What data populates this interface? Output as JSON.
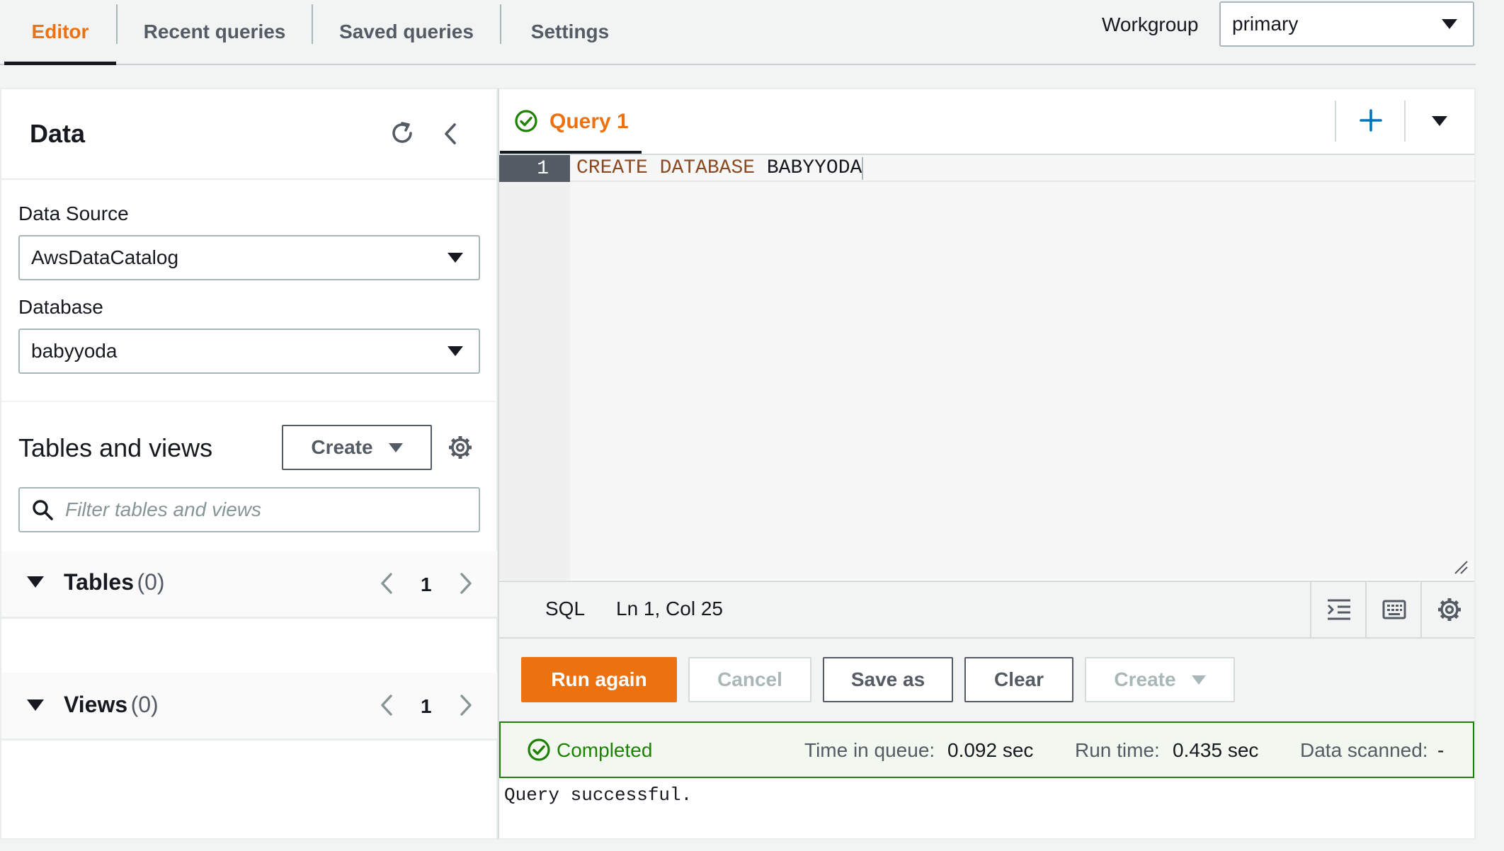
{
  "tabs": [
    {
      "label": "Editor",
      "active": true
    },
    {
      "label": "Recent queries",
      "active": false
    },
    {
      "label": "Saved queries",
      "active": false
    },
    {
      "label": "Settings",
      "active": false
    }
  ],
  "workgroup": {
    "label": "Workgroup",
    "value": "primary"
  },
  "data_panel": {
    "title": "Data",
    "data_source": {
      "label": "Data Source",
      "value": "AwsDataCatalog"
    },
    "database": {
      "label": "Database",
      "value": "babyyoda"
    },
    "tables_and_views": {
      "title": "Tables and views",
      "create_label": "Create",
      "filter_placeholder": "Filter tables and views"
    },
    "tables": {
      "title": "Tables",
      "count": "(0)",
      "page": "1"
    },
    "views": {
      "title": "Views",
      "count": "(0)",
      "page": "1"
    }
  },
  "query_tab": {
    "label": "Query 1",
    "status": "success"
  },
  "editor": {
    "line_number": "1",
    "code": {
      "kw1": "CREATE",
      "kw2": "DATABASE",
      "name": "BABYYODA"
    },
    "language": "SQL",
    "position": "Ln 1, Col 25"
  },
  "actions": {
    "run_again": "Run again",
    "cancel": "Cancel",
    "save_as": "Save as",
    "clear": "Clear",
    "create": "Create"
  },
  "result": {
    "status": "Completed",
    "time_in_queue_label": "Time in queue:",
    "time_in_queue_value": "0.092 sec",
    "run_time_label": "Run time:",
    "run_time_value": "0.435 sec",
    "data_scanned_label": "Data scanned:",
    "data_scanned_value": "-",
    "output": "Query successful."
  },
  "colors": {
    "accent": "#ec7211",
    "success": "#1d8102",
    "text": "#16191f",
    "muted": "#545b64"
  }
}
